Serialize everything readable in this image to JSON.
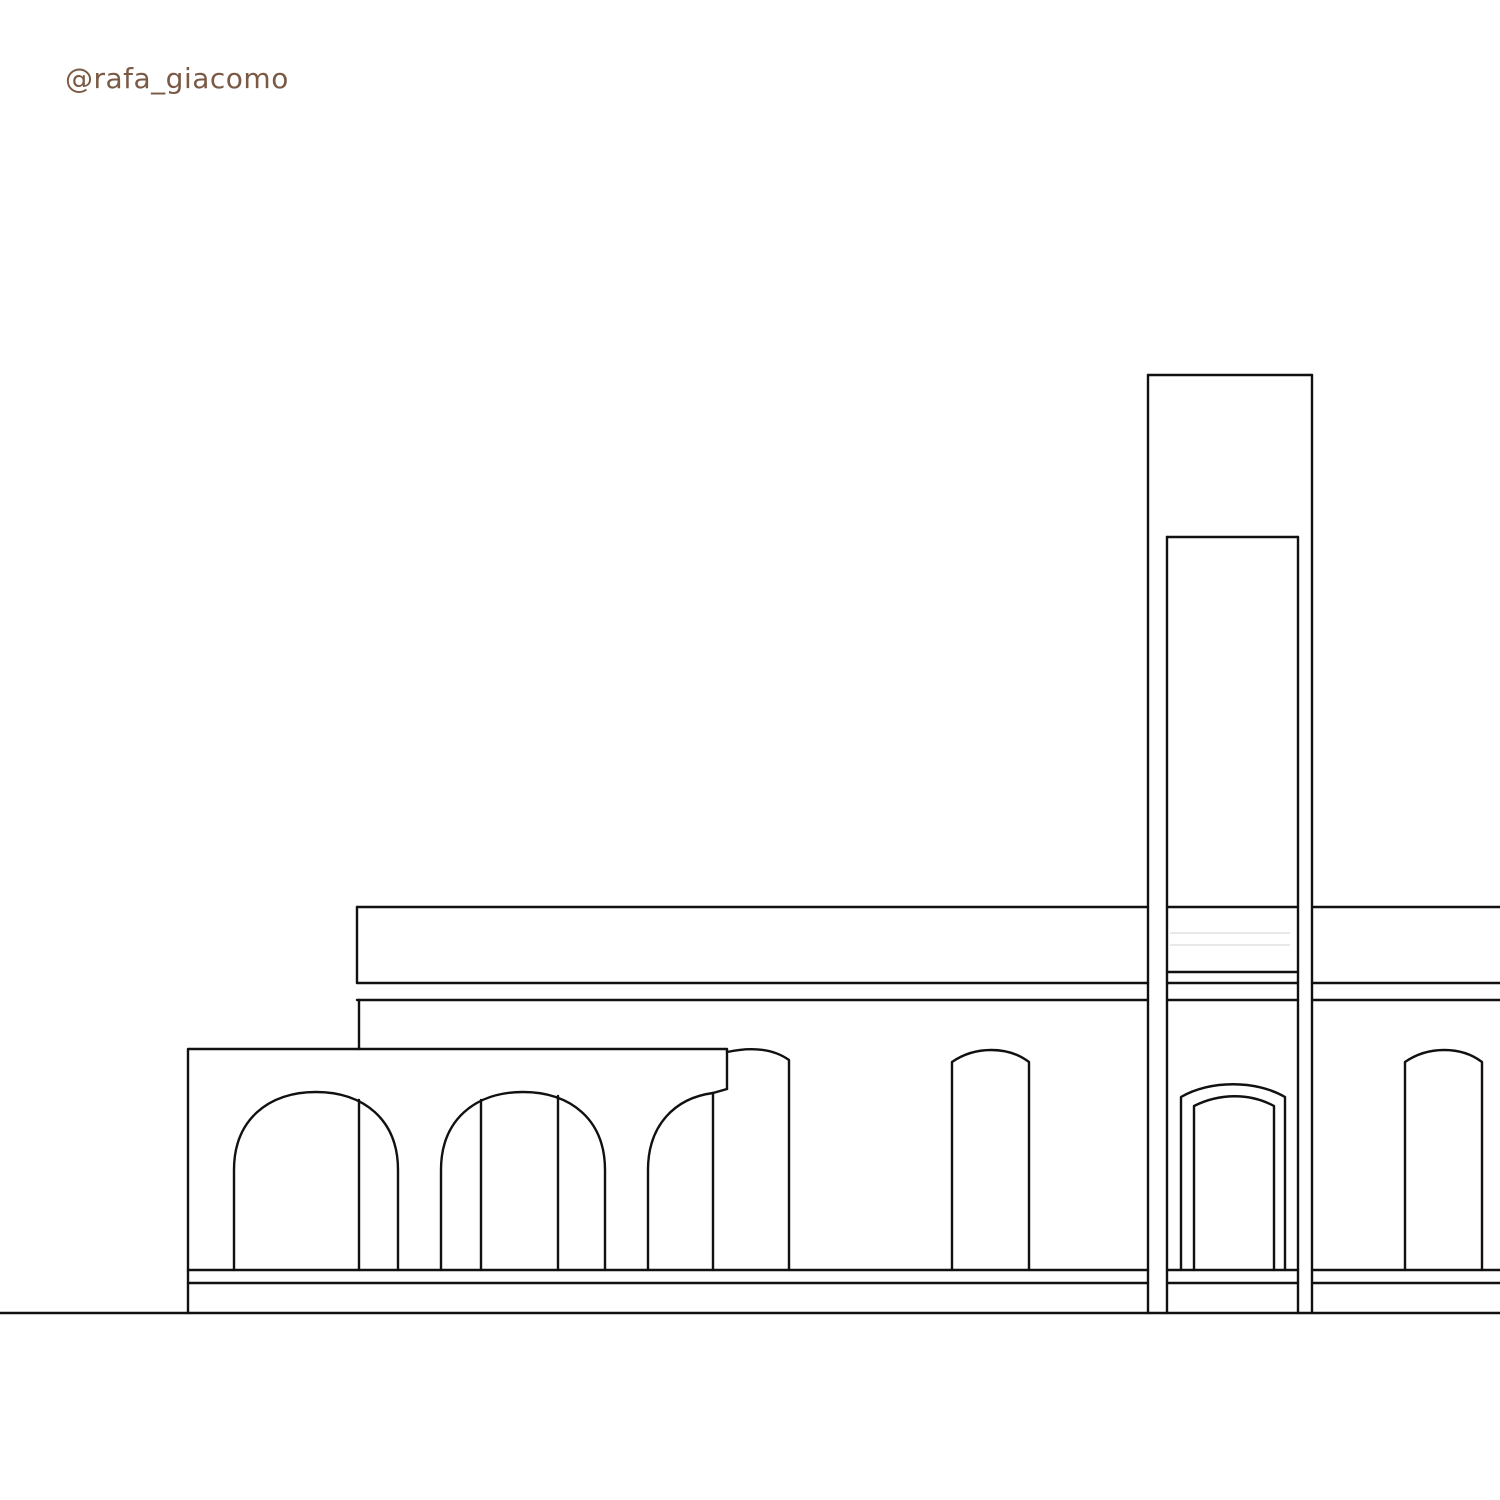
{
  "watermark": {
    "text": "@rafa_giacomo",
    "color": "#7a5a45"
  },
  "drawing": {
    "style": "line drawing, architectural elevation",
    "line_color": "#111111",
    "background": "#ffffff"
  }
}
